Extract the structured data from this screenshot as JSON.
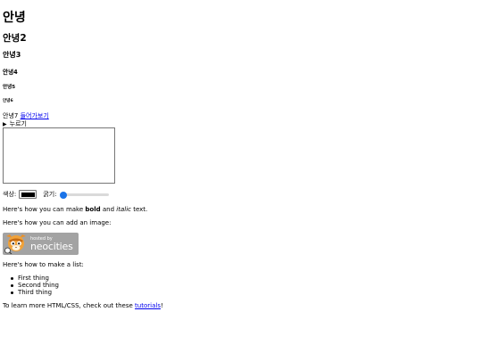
{
  "headings": {
    "h1": "안녕",
    "h2": "안녕2",
    "h3": "안녕3",
    "h4": "안녕4",
    "h5": "안녕5",
    "h6": "안녕6"
  },
  "para7": {
    "text": "안녕7 ",
    "link": "들어가보기"
  },
  "details": {
    "summary": "누르기"
  },
  "textarea": {
    "value": ""
  },
  "controls": {
    "color_label": "색상:",
    "color_value": "#000000",
    "width_label": "굵기:",
    "width_level": 0.06
  },
  "bold_line": {
    "prefix": "Here's how you can make ",
    "bold": "bold",
    "middle": " and ",
    "italic": "italic",
    "suffix": " text."
  },
  "image_line": {
    "text": "Here's how you can add an image:"
  },
  "badge": {
    "hosted_by": "hosted by",
    "name": "neocities"
  },
  "list": {
    "intro": "Here's how to make a list:",
    "items": [
      "First thing",
      "Second thing",
      "Third thing"
    ]
  },
  "footer": {
    "prefix": "To learn more HTML/CSS, check out these ",
    "link": "tutorials",
    "suffix": "!"
  }
}
